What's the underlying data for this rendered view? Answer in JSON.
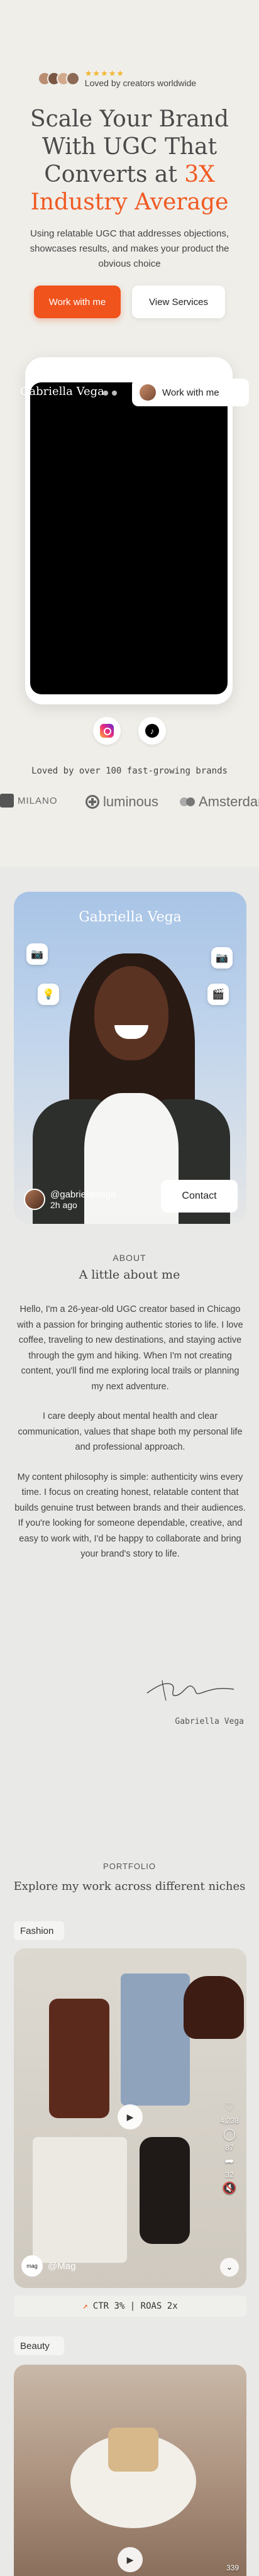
{
  "hero": {
    "stars": "★★★★★",
    "proof_text": "Loved by creators worldwide",
    "headline_part1": "Scale Your Brand With UGC That Converts at ",
    "headline_accent": "3X Industry Average",
    "subhead": "Using relatable UGC that addresses objections, showcases results, and makes your product the obvious choice",
    "primary_cta": "Work with me",
    "secondary_cta": "View Services",
    "accent_color": "#f05a22"
  },
  "video": {
    "title": "Gabriella Vega",
    "pill_label": "Work with me"
  },
  "socials": {
    "instagram_icon": "instagram-icon",
    "tiktok_icon": "tiktok-icon",
    "tiktok_glyph": "♪"
  },
  "brands": {
    "caption": "Loved by over 100 fast-growing brands",
    "items": [
      "MILANO",
      "luminous",
      "Amsterdam"
    ]
  },
  "profile": {
    "name": "Gabriella Vega",
    "handle": "@gabriellavega",
    "time": "2h ago",
    "contact": "Contact",
    "float_icons": [
      "📷",
      "📷",
      "💡",
      "🎬"
    ]
  },
  "about": {
    "label": "ABOUT",
    "title": "A little about me",
    "paragraphs": [
      "Hello, I'm a 26-year-old UGC creator based in Chicago with a passion for bringing authentic stories to life. I love coffee, traveling to new destinations, and staying active through the gym and hiking. When I'm not creating content, you'll find me exploring local trails or planning my next adventure.",
      "I care deeply about mental health and clear communication, values that shape both my personal life and professional approach.",
      "My content philosophy is simple: authenticity wins every time. I focus on creating honest, relatable content that builds genuine trust between brands and their audiences. If you're looking for someone dependable, creative, and easy to work with, I'd be happy to collaborate and bring your brand's story to life."
    ],
    "signature_name": "Gabriella Vega"
  },
  "portfolio": {
    "label": "PORTFOLIO",
    "title": "Explore my work across different niches",
    "fashion": {
      "label": "Fashion",
      "likes": "4,238",
      "comments": "87",
      "shares": "32",
      "handle": "@Mag",
      "avatar_text": "mag",
      "stats": "CTR 3% | ROAS 2x"
    },
    "beauty": {
      "label": "Beauty",
      "counter": "339"
    }
  }
}
